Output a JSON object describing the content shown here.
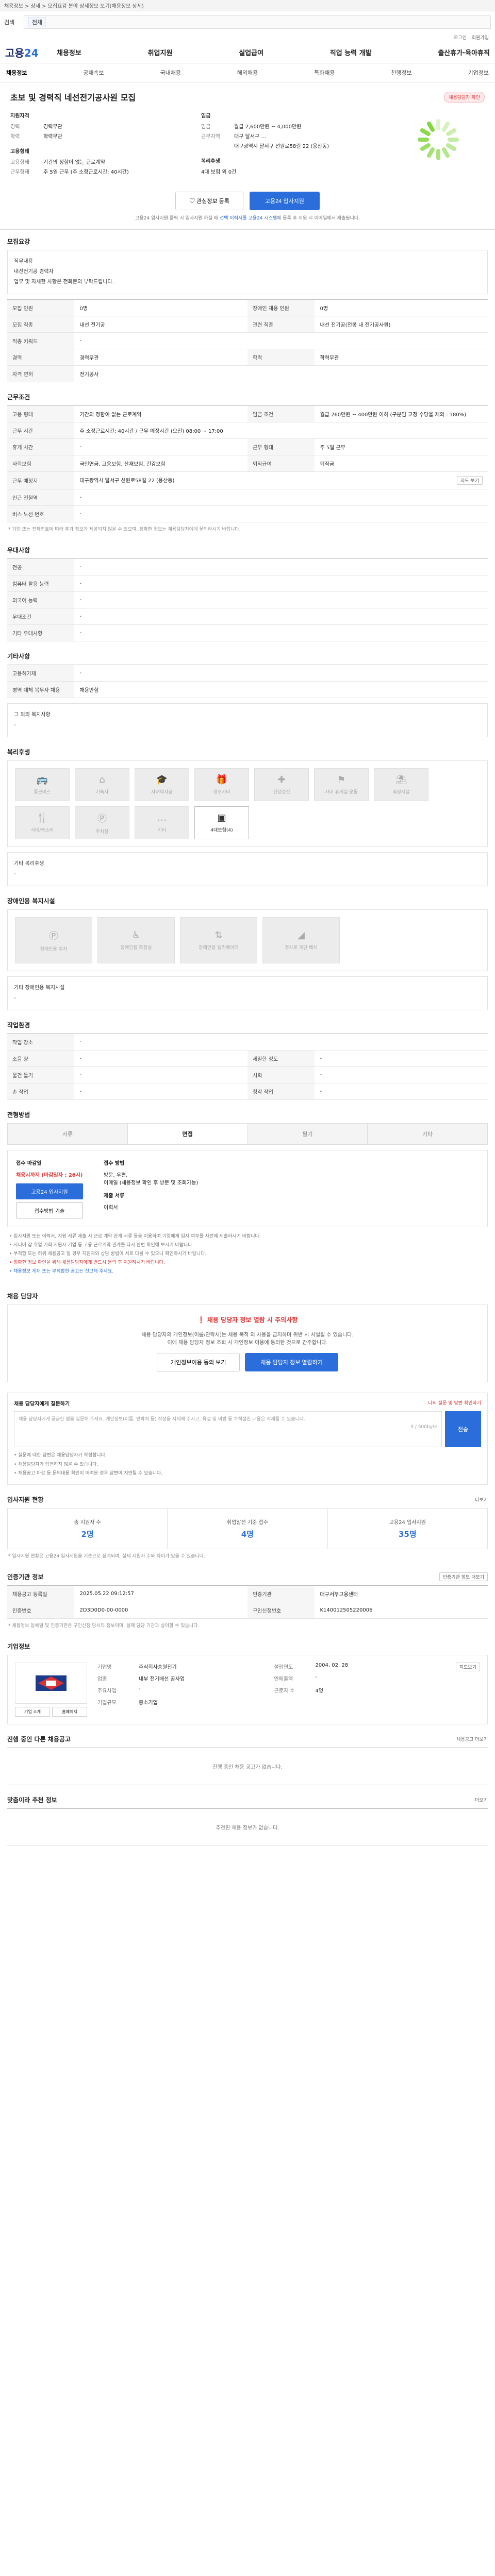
{
  "topbar": {
    "breadcrumb": "채용정보 > 상세 > 모집요강 분야 상세정보 보기(채용정보 상세)"
  },
  "search": {
    "label": "검색",
    "tag": "전체",
    "placeholder": ""
  },
  "util": [
    "로그인",
    "회원가입"
  ],
  "gnb": {
    "logo_main": "고용",
    "logo_accent": "24",
    "menu": [
      "채용정보",
      "취업지원",
      "실업급여",
      "직업 능력 개발",
      "출산휴가·육아휴직"
    ]
  },
  "lnb": [
    "채용정보",
    "공채속보",
    "국내채용",
    "해외채용",
    "특화채용",
    "천행정보",
    "기업정보"
  ],
  "job": {
    "title": "초보 및 경력직 네선전기공사원 모집",
    "verify_badge": "채용담당자 확인",
    "group1_title": "지원자격",
    "group1": [
      {
        "k": "경력",
        "v": "경력무관"
      },
      {
        "k": "학력",
        "v": "학력무관"
      }
    ],
    "group2_title": "고용형태",
    "group2": [
      {
        "k": "고용형태",
        "v": "기간의 정함이 없는 근로계약"
      },
      {
        "k": "근무형태",
        "v": "주 5일 근무 (주 소정근로시간: 40시간)"
      }
    ],
    "group3_title": "임금",
    "group3": [
      {
        "k": "임금",
        "v": "월급 2,600만원 ~ 4,000만원"
      },
      {
        "k": "근무지역",
        "v": "대구 달서구 ..."
      },
      {
        "k": "",
        "v": "대구광역시 달서구 선원로58길 22 (용산동)"
      }
    ],
    "group4_title": "복리후생",
    "group4": [
      {
        "k": "",
        "v": "4대 보험 외 0건"
      }
    ],
    "btn_interest": "관심정보 등록",
    "btn_apply": "고용24 입사지원",
    "note_prefix": "고용24 입사지원 클릭 시 입사지원 하실 때 ",
    "note_link": "선택 이력서를 고용24 시스템",
    "note_suffix": "에 등록 후 지원 시 이메일에서 제출됩니다."
  },
  "recruit": {
    "title": "모집요강",
    "box_lines": [
      "직무내용",
      "내선전기공 경력자",
      "업무 및 자세한 사항은 전화문의 부탁드립니다."
    ],
    "rows": [
      [
        "모집 인원",
        "0명",
        "장애인 채용 인원",
        "0명"
      ],
      [
        "모집 직종",
        "내선 전기공",
        "관련 직종",
        "내선 전기공(전봉 내 전기공사원)"
      ],
      [
        "직종 키워드",
        "-",
        "",
        ""
      ],
      [
        "경력",
        "경력무관",
        "학력",
        "학력무관"
      ],
      [
        "자격 면허",
        "전기공사",
        "",
        ""
      ]
    ]
  },
  "work": {
    "title": "근무조건",
    "rows": [
      [
        "고용 형태",
        "기간의 정함이 없는 근로계약",
        "임금 조건",
        "월급 260만원 ~ 400만원 이하 (구분임 고정 수당을 제외 : 180%)"
      ],
      [
        "근무 시간",
        "주 소정근로시간: 40시간 / 근무 예정시간 (오전) 08:00 ~ 17:00",
        "",
        ""
      ],
      [
        "휴게 시간",
        "-",
        "근무 형태",
        "주 5일 근무"
      ],
      [
        "사회보험",
        "국민연금, 고용보험, 산재보험, 건강보험",
        "퇴직급여",
        "퇴직금"
      ],
      [
        "근무 예정지",
        "대구광역시 달서구 선원로58길 22 (용산동)",
        "",
        ""
      ],
      [
        "인근 전철역",
        "-",
        "",
        ""
      ],
      [
        "버스 노선 번호",
        "-",
        "",
        ""
      ]
    ],
    "map_btn": "지도 보기",
    "footnote": "* 기업 또는 전화번호에 따라 추가 정보가 제공되지 않을 수 있으며, 정확한 정보는 채용담당자에게 문의하시기 바랍니다."
  },
  "pref": {
    "title": "우대사항",
    "rows": [
      [
        "전공",
        "-"
      ],
      [
        "컴퓨터 활용 능력",
        "-"
      ],
      [
        "외국어 능력",
        "-"
      ],
      [
        "우대조건",
        "-"
      ],
      [
        "기타 우대사항",
        "-"
      ]
    ]
  },
  "etc": {
    "title": "기타사항",
    "rows": [
      [
        "고용허가제",
        "-"
      ],
      [
        "병역 대체 복무자 채용",
        "채용안함"
      ]
    ],
    "other_label": "그 외의 복지사항",
    "other_val": "-"
  },
  "benefit": {
    "title": "복리후생",
    "items": [
      {
        "label": "통근버스",
        "icon": "bus-icon",
        "on": false
      },
      {
        "label": "기숙사",
        "icon": "dorm-icon",
        "on": false
      },
      {
        "label": "자녀학자금",
        "icon": "graduation-icon",
        "on": false
      },
      {
        "label": "경조사비",
        "icon": "gift-icon",
        "on": false
      },
      {
        "label": "건강검진",
        "icon": "health-icon",
        "on": false
      },
      {
        "label": "사내 휴게실·운동",
        "icon": "gym-icon",
        "on": false
      },
      {
        "label": "휴양시설",
        "icon": "resort-icon",
        "on": false
      },
      {
        "label": "식대/숙소비",
        "icon": "meal-icon",
        "on": false
      },
      {
        "label": "주차장",
        "icon": "parking-icon",
        "on": false
      },
      {
        "label": "기타",
        "icon": "etc-icon",
        "on": false
      },
      {
        "label": "4대보험(4)",
        "icon": "insurance-icon",
        "on": true
      }
    ],
    "other_label": "기타 복리후생",
    "other_val": "-"
  },
  "disab": {
    "title": "장애인용 복지시설",
    "items": [
      "장애인용 주차",
      "장애인용 화장실",
      "장애인용 엘리베이터",
      "경사로 계단 배치"
    ],
    "other_label": "기타 장애인용 복지시설",
    "other_val": "-"
  },
  "worktask": {
    "title": "작업환경",
    "rows": [
      [
        "작업 장소",
        "-",
        "",
        ""
      ],
      [
        "소음 량",
        "-",
        "세밀한 정도",
        "-"
      ],
      [
        "물건 들기",
        "-",
        "시력",
        "-"
      ],
      [
        "손 작업",
        "-",
        "청각 작업",
        "-"
      ]
    ]
  },
  "process": {
    "title": "전형방법",
    "tabs": [
      "서류",
      "면접",
      "필기",
      "기타"
    ],
    "active": 1,
    "m1_title": "접수 마감일",
    "deadline": "채용시까지 (마감일자 : 26시)",
    "apply": "고용24 입사지원",
    "ghost": "접수방법 기술",
    "m2_title": "접수 방법",
    "m2_lines": [
      "방문, 우편,",
      "이메일 (채용정보 확인 후 방문 및 조회가능)"
    ],
    "m2_sub": "제출 서류",
    "m2_sub_val": "이력서",
    "bullets": [
      "• 입사지원 또는 이력서, 지원 서류 제출 시 근로 계약 관계 서류 등을 이용하여 기업에게 입사 여부를 사전에 제출하시기 바랍니다.",
      "• 시니어 잡 취업 기회 지원시 기업 등 고용 근로계약 관계를 다시 한번 확인해 보시기 바랍니다.",
      "• 부적합 또는 허위 채용공고 일 경우 지원자와 상담 방법이 서로 다를 수 있으니 확인하시기 바랍니다."
    ],
    "bullets_red": "• 정확한 정보 확인을 위해 채용담당자에게 반드시 문의 후 지원하시기 바랍니다.",
    "bullets_blue": "• 채용정보 게재 또는 부적합한 공고는 신고해 주세요."
  },
  "contact": {
    "title": "채용 담당자",
    "warn": "채용 담당자 정보 열람 시 주의사항",
    "line1": "채용 담당자의 개인정보(이름/연락처)는 채용 목적 외 사용을 금지하며 위반 시 처벌될 수 있습니다.",
    "line2": "이에 채용 담당자 정보 조회 시 개인정보 이용에 동의한 것으로 간주합니다.",
    "btn1": "개인정보이용 동의 보기",
    "btn2": "채용 담당자 정보 열람하기"
  },
  "inquiry": {
    "title": "채용 담당자에게 질문하기",
    "right": "나의 질문 및 답변 확인하기",
    "placeholder": "채용 담당자에게 궁금한 점을 질문해 주세요. 개인정보(이름, 연락처 등) 작성을 자제해 주시고, 욕설 및 비방 등 부적절한 내용은 삭제될 수 있습니다.",
    "count": "0 / 500byte",
    "send": "전송",
    "b1": "• 질문에 대한 답변은 채용담당자가 작성합니다.",
    "b2": "• 채용담당자가 답변하지 않을 수 있습니다.",
    "b3": "• 채용공고 마감 등 문의내용 확인이 어려운 경우 답변이 지연될 수 있습니다."
  },
  "stats": {
    "title": "입사지원 현황",
    "more": "더보기",
    "items": [
      {
        "label": "총 지원자 수",
        "value": "2명"
      },
      {
        "label": "취업알선 기준 접수",
        "value": "4명"
      },
      {
        "label": "고용24 입사지원",
        "value": "35명"
      }
    ],
    "note": "* 입사지원 현황은 고용24 입사지원을 기준으로 집계되며, 실제 지원자 수와 차이가 있을 수 있습니다."
  },
  "certinfo": {
    "title": "인증기관 정보",
    "btn": "인증기관 정보 더보기",
    "rows": [
      [
        "채용공고 등록일",
        "2025.05.22 09:12:57",
        "인증기관",
        "대구서부고용센터"
      ],
      [
        "인증번호",
        "2D3D0D0-00-0000",
        "구인신청번호",
        "K140012505220006"
      ]
    ],
    "note": "* 채용정보 등록일 및 인증기관은 구인신청 당시의 정보이며, 실제 담당 기관과 상이할 수 있습니다."
  },
  "company": {
    "title": "기업정보",
    "btn_intro": "기업 소개",
    "btn_home": "홈페이지",
    "info": [
      [
        "기업명",
        "주식회사승원전기",
        "설립연도",
        "2004. 02. 28"
      ],
      [
        "업종",
        "내부 전기배선 공사업",
        "연매출액",
        "-"
      ],
      [
        "주요사업",
        "-",
        "근로자 수",
        "4명"
      ],
      [
        "기업규모",
        "중소기업",
        "",
        ""
      ]
    ],
    "map_btn": "지도보기"
  },
  "others": {
    "title": "진행 중인 다른 채용공고",
    "more": "채용공고 더보기",
    "empty": "진행 중인 채용 공고가 없습니다."
  },
  "recom": {
    "title": "맞춤이라 추천 정보",
    "more": "더보기",
    "empty": "추천된 채용 정보가 없습니다."
  }
}
